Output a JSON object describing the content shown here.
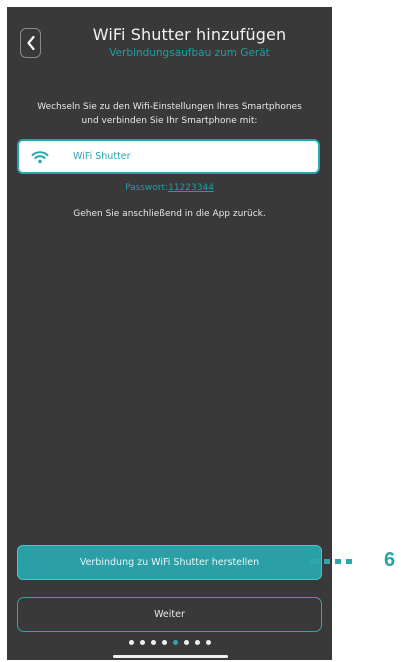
{
  "header": {
    "title": "WiFi Shutter hinzufügen",
    "subtitle": "Verbindungsaufbau zum Gerät"
  },
  "instruction": {
    "line1": "Wechseln Sie zu den Wifi-Einstellungen Ihres Smartphones",
    "line2": "und verbinden Sie Ihr Smartphone mit:"
  },
  "wifi_entry": {
    "name": "WiFi Shutter",
    "icon": "wifi-icon"
  },
  "password": {
    "label": "Passwort:",
    "value": "11223344"
  },
  "return_text": "Gehen Sie anschließend in die App zurück.",
  "buttons": {
    "connect": "Verbindung zu WiFi Shutter herstellen",
    "next": "Weiter"
  },
  "pager": {
    "total": 8,
    "active_index": 4
  },
  "callout": {
    "number": "6"
  },
  "colors": {
    "background": "#393939",
    "accent": "#2da7ae",
    "text": "#e8e8e8"
  }
}
